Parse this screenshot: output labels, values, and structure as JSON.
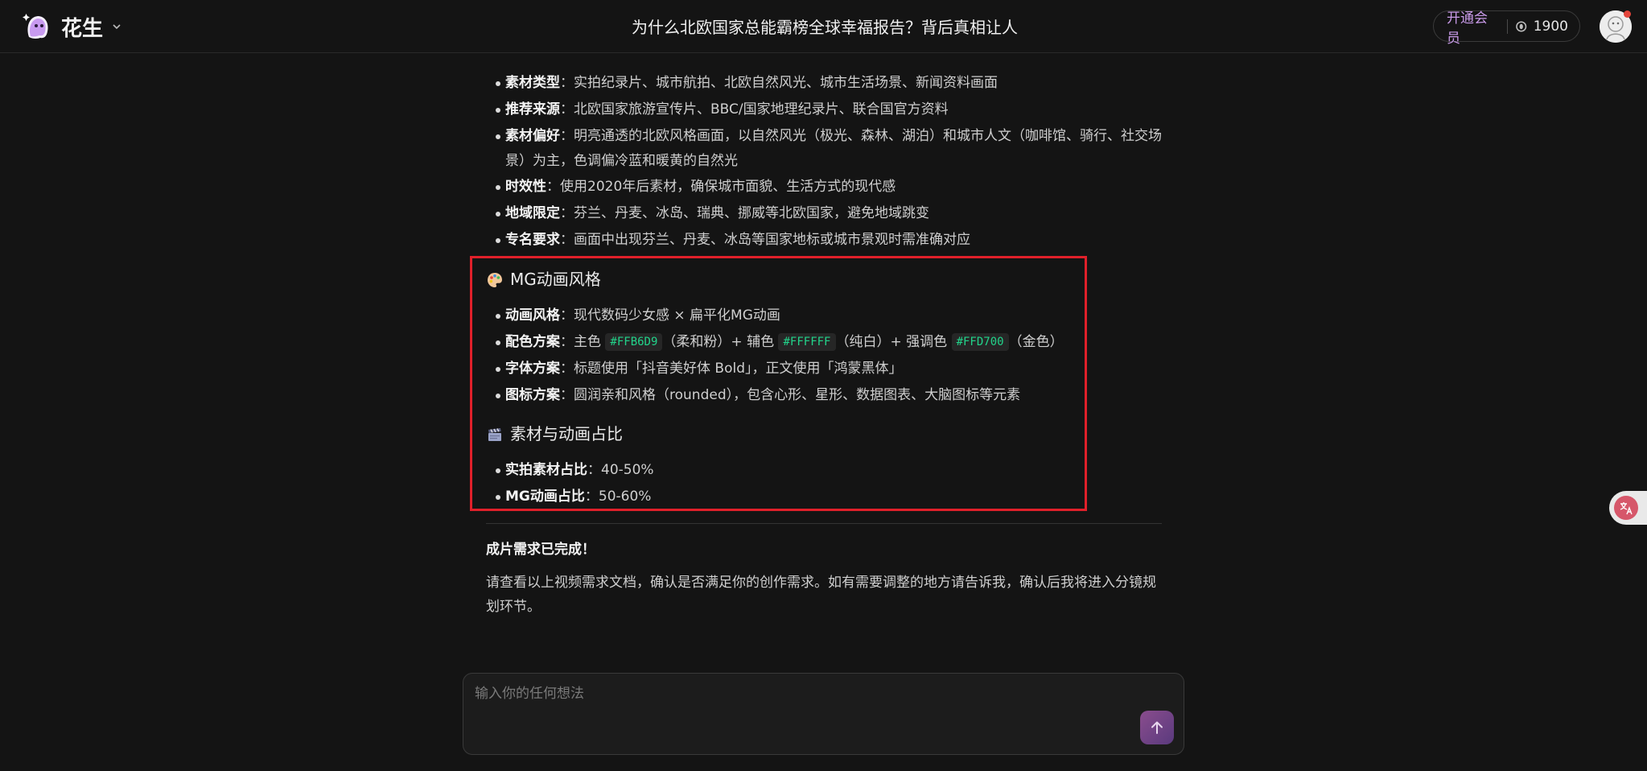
{
  "header": {
    "brand_name": "花生",
    "doc_title": "为什么北欧国家总能霸榜全球幸福报告？背后真相让人",
    "vip_label": "开通会员",
    "coin_count": "1900"
  },
  "sourcing": {
    "items": [
      {
        "key": "素材类型",
        "value": "：实拍纪录片、城市航拍、北欧自然风光、城市生活场景、新闻资料画面"
      },
      {
        "key": "推荐来源",
        "value": "：北欧国家旅游宣传片、BBC/国家地理纪录片、联合国官方资料"
      },
      {
        "key": "素材偏好",
        "value": "：明亮通透的北欧风格画面，以自然风光（极光、森林、湖泊）和城市人文（咖啡馆、骑行、社交场景）为主，色调偏冷蓝和暖黄的自然光"
      },
      {
        "key": "时效性",
        "value": "：使用2020年后素材，确保城市面貌、生活方式的现代感"
      },
      {
        "key": "地域限定",
        "value": "：芬兰、丹麦、冰岛、瑞典、挪威等北欧国家，避免地域跳变"
      },
      {
        "key": "专名要求",
        "value": "：画面中出现芬兰、丹麦、冰岛等国家地标或城市景观时需准确对应"
      }
    ]
  },
  "mg_style": {
    "heading": "MG动画风格",
    "anim_key": "动画风格",
    "anim_value": "：现代数码少女感 × 扁平化MG动画",
    "color_key": "配色方案",
    "color_main_label": "：主色",
    "color_main_code": "#FFB6D9",
    "color_main_note": "（柔和粉）+ 辅色",
    "color_sub_code": "#FFFFFF",
    "color_sub_note": "（纯白）+ 强调色",
    "color_accent_code": "#FFD700",
    "color_accent_note": "（金色）",
    "font_key": "字体方案",
    "font_value": "：标题使用「抖音美好体 Bold」，正文使用「鸿蒙黑体」",
    "icon_key": "图标方案",
    "icon_value": "：圆润亲和风格（rounded），包含心形、星形、数据图表、大脑图标等元素"
  },
  "ratio": {
    "heading": "素材与动画占比",
    "live_key": "实拍素材占比",
    "live_value": "：40-50%",
    "mg_key": "MG动画占比",
    "mg_value": "：50-60%"
  },
  "closing": {
    "title": "成片需求已完成！",
    "text": "请查看以上视频需求文档，确认是否满足你的创作需求。如有需要调整的地方请告诉我，确认后我将进入分镜规划环节。"
  },
  "composer": {
    "placeholder": "输入你的任何想法"
  },
  "colors": {
    "background": "#141414",
    "accent_vip": "#c89ae8",
    "code_text": "#22d38a",
    "highlight_border": "#e0202a"
  },
  "icons": [
    "peanut-ghost-logo",
    "chevron-down-icon",
    "coin-icon",
    "palette-icon",
    "clapper-icon",
    "arrow-up-icon",
    "translate-icon"
  ]
}
